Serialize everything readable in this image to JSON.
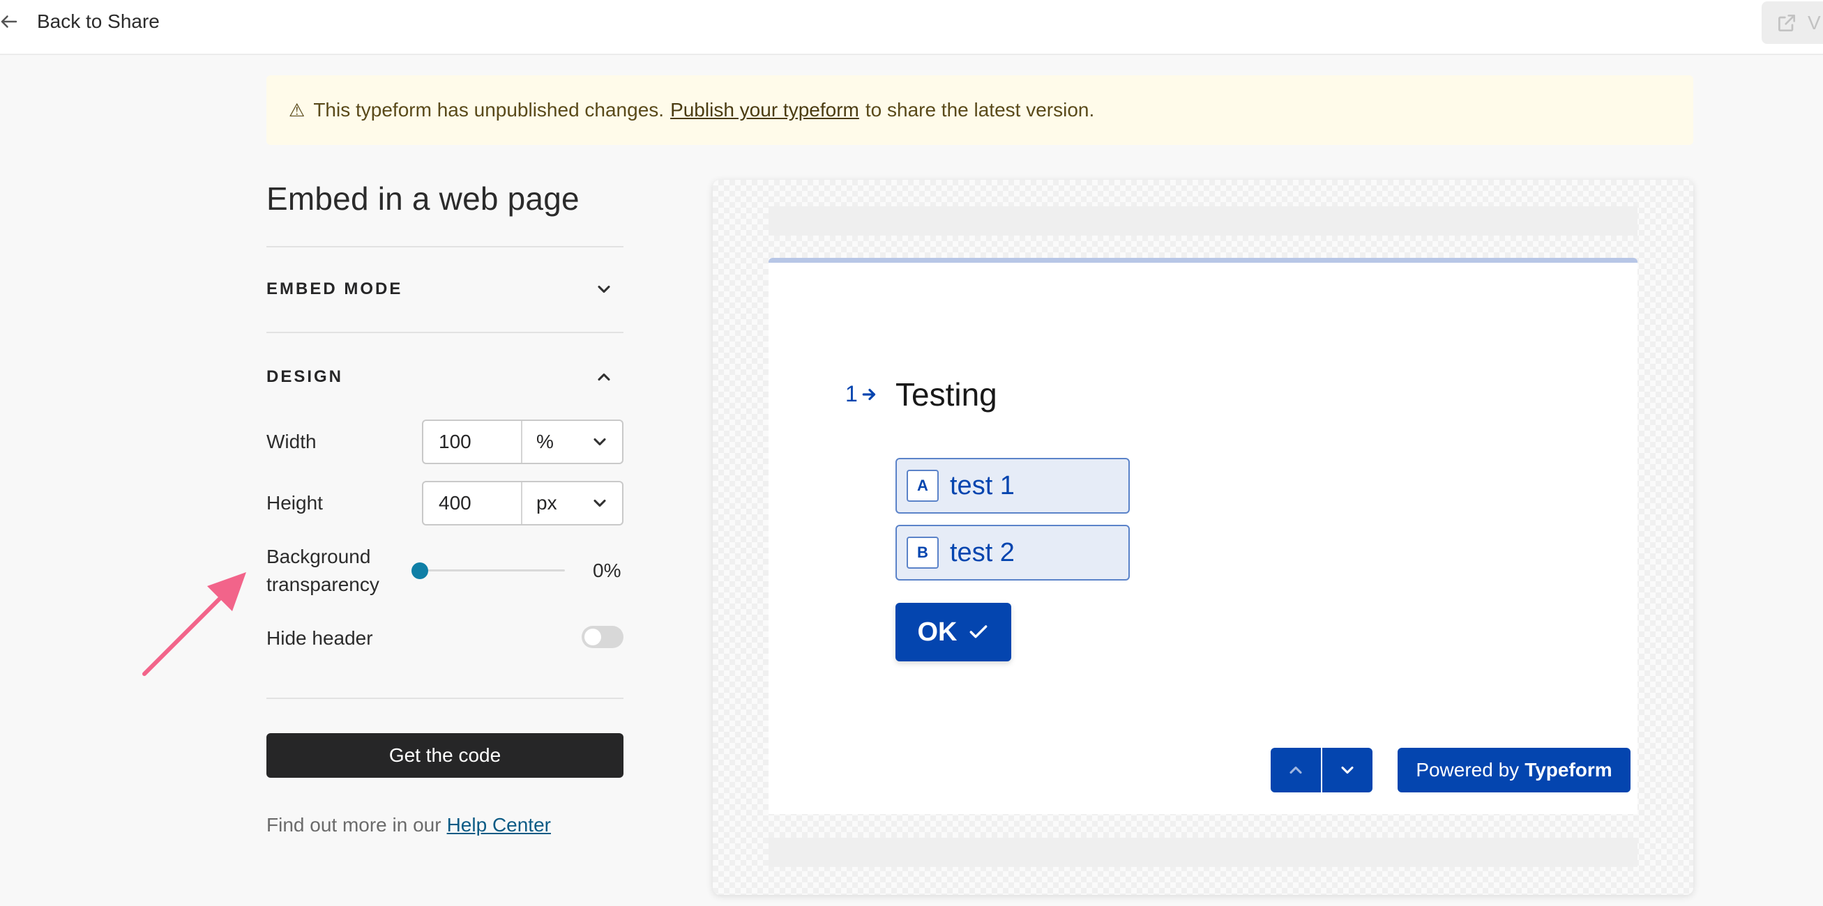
{
  "header": {
    "back_label": "Back to Share",
    "view_label": "V"
  },
  "banner": {
    "icon": "warning-icon",
    "text_before": "This typeform has unpublished changes.",
    "link_text": "Publish your typeform",
    "text_after": "to share the latest version."
  },
  "panel": {
    "title": "Embed in a web page",
    "embed_mode_label": "EMBED MODE",
    "design_label": "DESIGN",
    "width_label": "Width",
    "width_value": "100",
    "width_unit": "%",
    "height_label": "Height",
    "height_value": "400",
    "height_unit": "px",
    "bg_label_line1": "Background",
    "bg_label_line2": "transparency",
    "bg_value": "0%",
    "bg_level": 0,
    "hide_header_label": "Hide header",
    "hide_header_on": false,
    "get_code_label": "Get the code",
    "help_text": "Find out more in our",
    "help_link": "Help Center"
  },
  "preview": {
    "question_number": "1",
    "question_title": "Testing",
    "choices": [
      {
        "key": "A",
        "label": "test 1"
      },
      {
        "key": "B",
        "label": "test 2"
      }
    ],
    "ok_label": "OK",
    "powered_prefix": "Powered by",
    "powered_brand": "Typeform",
    "brand_color": "#0445af"
  },
  "colors": {
    "banner_bg": "#fffbea",
    "slider_thumb": "#0f7fa6",
    "annotation_arrow": "#f2648a"
  }
}
